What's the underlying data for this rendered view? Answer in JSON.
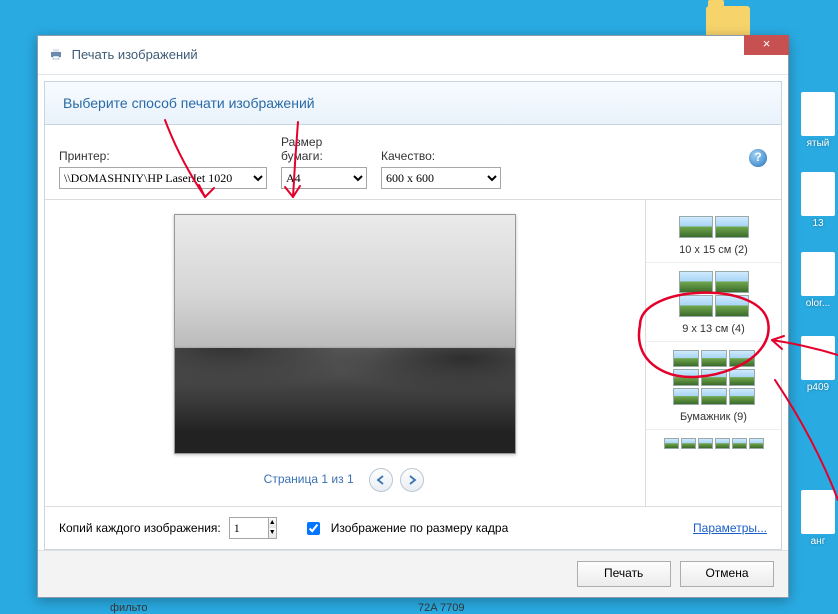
{
  "desktop_icons": [
    {
      "type": "folder",
      "label": ""
    },
    {
      "type": "file",
      "label": "ятый"
    },
    {
      "type": "file",
      "label": "olor..."
    },
    {
      "type": "file",
      "label": "13"
    },
    {
      "type": "file",
      "label": "p409"
    },
    {
      "type": "file",
      "label": "анг"
    }
  ],
  "dialog": {
    "title": "Печать изображений",
    "heading": "Выберите способ печати изображений",
    "printer_label": "Принтер:",
    "printer_value": "\\\\DOMASHNIY\\HP LaserJet 1020",
    "paper_label": "Размер бумаги:",
    "paper_value": "A4",
    "quality_label": "Качество:",
    "quality_value": "600 x 600",
    "pager_text": "Страница 1 из 1",
    "copies_label": "Копий каждого изображения:",
    "copies_value": "1",
    "fit_checked": true,
    "fit_label": "Изображение по размеру кадра",
    "params_link": "Параметры...",
    "print_btn": "Печать",
    "cancel_btn": "Отмена",
    "layouts": [
      {
        "caption": "10 x 15 см (2)",
        "cols": 2,
        "rows": 1,
        "cell": "sm"
      },
      {
        "caption": "9 x 13 см (4)",
        "cols": 2,
        "rows": 2,
        "cell": "sm",
        "selected": true
      },
      {
        "caption": "Бумажник (9)",
        "cols": 3,
        "rows": 3,
        "cell": "xs"
      },
      {
        "caption": "",
        "cols": 6,
        "rows": 1,
        "cell": "t"
      }
    ]
  },
  "statusbar_left": "фильто",
  "statusbar_mid": "72A 7709"
}
